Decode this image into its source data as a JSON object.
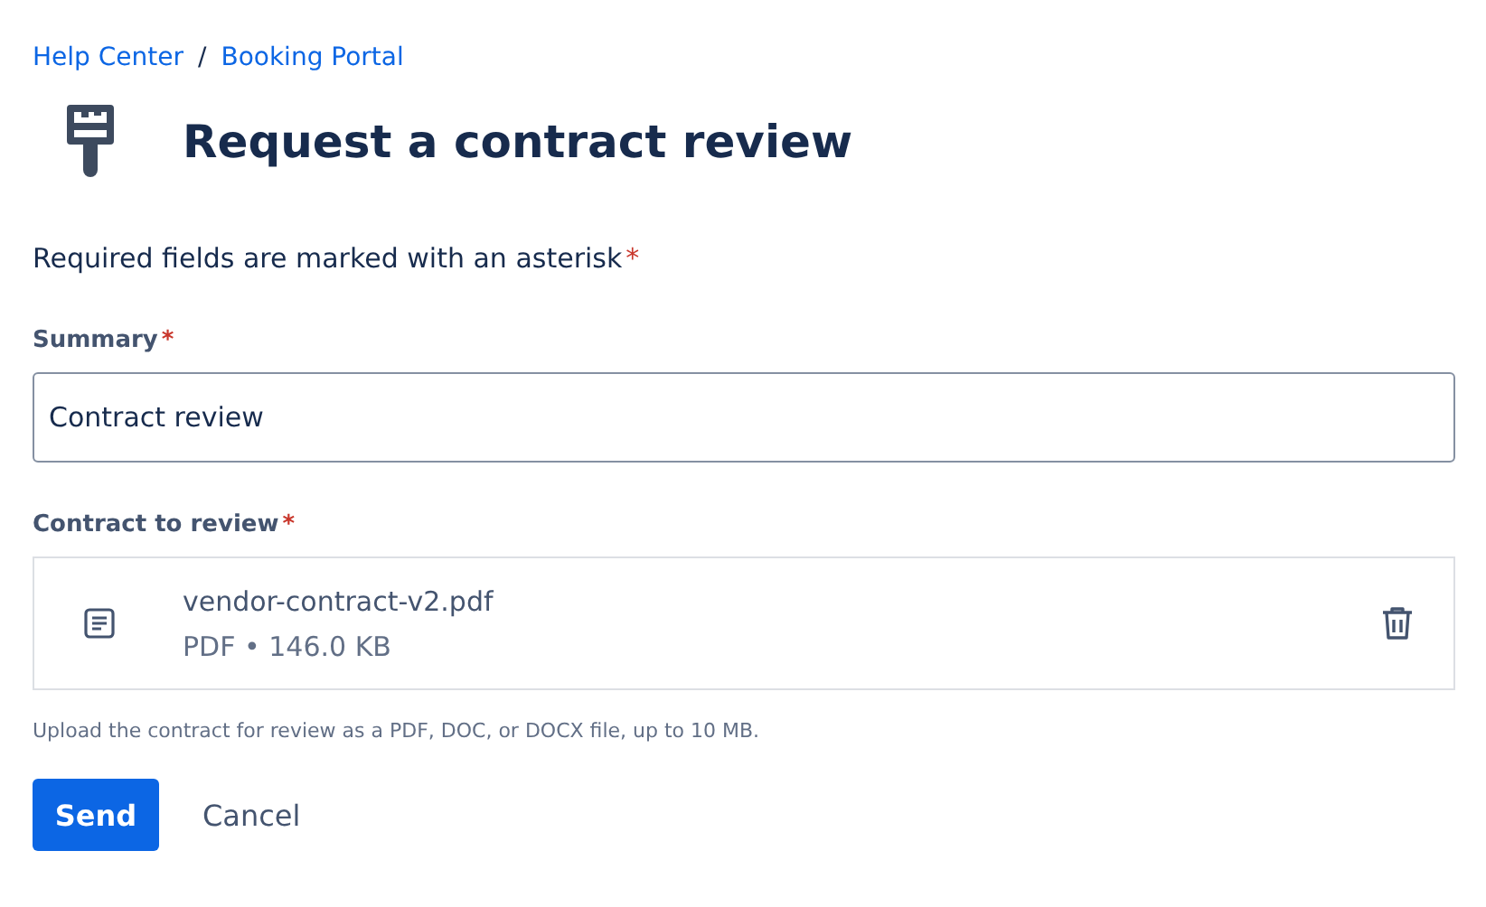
{
  "breadcrumbs": [
    "Help Center",
    "Booking Portal"
  ],
  "breadcrumb_separator": "/",
  "title": "Request a contract review",
  "required_note": "Required fields are marked with an asterisk",
  "required_mark": "*",
  "summary": {
    "label": "Summary",
    "required": true,
    "value": "Contract review"
  },
  "attachment": {
    "label": "Contract to review",
    "required": true,
    "file_name": "vendor-contract-v2.pdf",
    "file_info": "PDF • 146.0 KB",
    "help": "Upload the contract for review as a PDF, DOC, or DOCX file, up to 10 MB."
  },
  "buttons": [
    {
      "label": "Send",
      "kind": "primary"
    },
    {
      "label": "Cancel",
      "kind": "subtle"
    }
  ]
}
